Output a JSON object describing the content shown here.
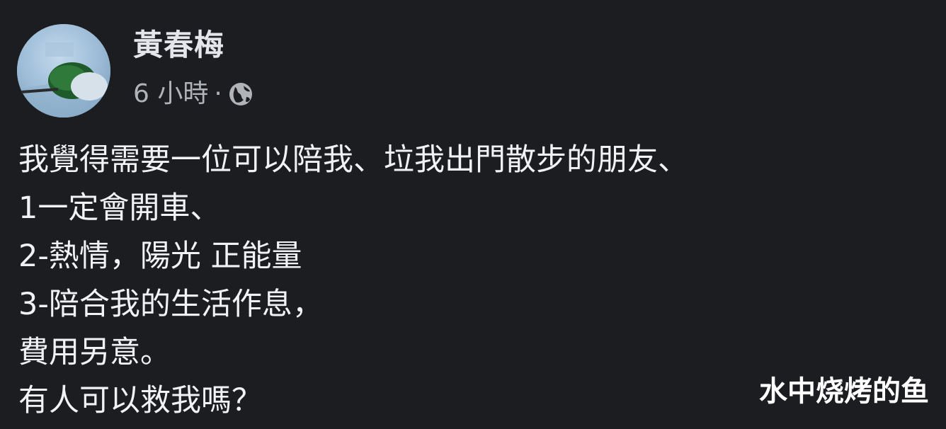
{
  "post": {
    "author_name": "黃春梅",
    "timestamp": "6 小時",
    "separator": "·",
    "audience_icon": "globe-icon",
    "lines": [
      "我覺得需要一位可以陪我、垃我出門散步的朋友、",
      "1一定會開車、",
      "2-熱情，陽光 正能量",
      "3-陪合我的生活作息，",
      "費用另意。",
      "有人可以救我嗎？"
    ]
  },
  "watermark": {
    "text": "水中烧烤的鱼"
  },
  "colors": {
    "background": "#1c1d21",
    "primary_text": "#e4e6eb",
    "secondary_text": "#b0b3b8"
  }
}
